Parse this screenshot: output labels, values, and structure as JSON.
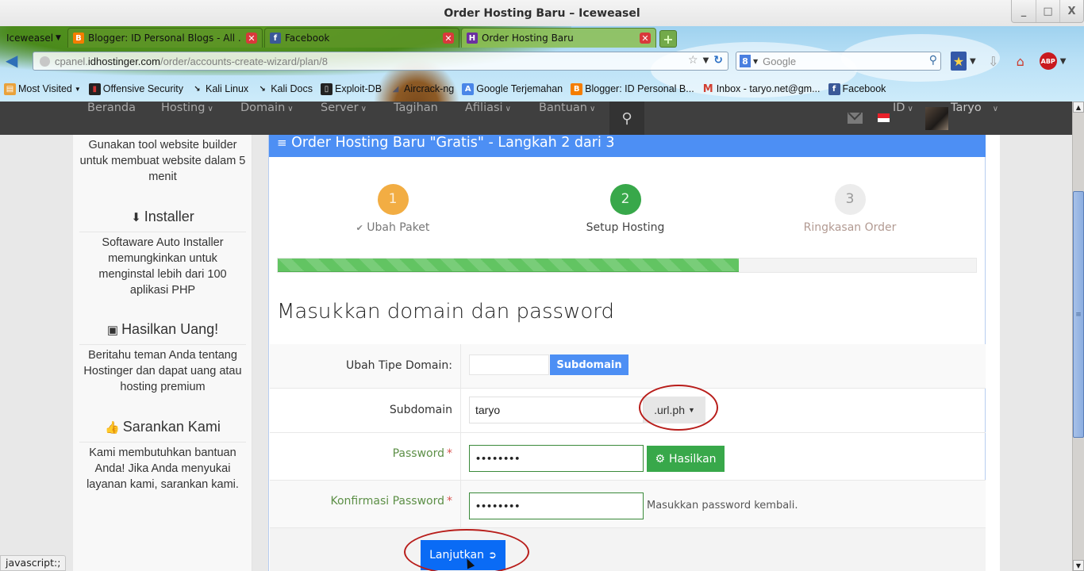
{
  "window": {
    "title": "Order Hosting Baru – Iceweasel",
    "controls": {
      "minimize": "_",
      "maximize": "□",
      "close": "X"
    }
  },
  "browser": {
    "app_menu": "Iceweasel",
    "tabs": [
      {
        "label": "Blogger: ID Personal Blogs - All ...",
        "icon": "blogger-icon",
        "active": false
      },
      {
        "label": "Facebook",
        "icon": "facebook-icon",
        "active": false
      },
      {
        "label": "Order Hosting Baru",
        "icon": "hostinger-icon",
        "active": true
      }
    ],
    "new_tab": "+",
    "url": {
      "prefix": "cpanel.",
      "domain": "idhostinger.com",
      "path": "/order/accounts-create-wizard/plan/8"
    },
    "search": {
      "engine": "8",
      "placeholder": "Google"
    },
    "bookmarks": [
      {
        "label": "Most Visited",
        "icon": "most-visited-icon",
        "dropdown": true
      },
      {
        "label": "Offensive Security",
        "icon": "offsec-icon"
      },
      {
        "label": "Kali Linux",
        "icon": "kali-icon"
      },
      {
        "label": "Kali Docs",
        "icon": "kali-icon"
      },
      {
        "label": "Exploit-DB",
        "icon": "exploitdb-icon"
      },
      {
        "label": "Aircrack-ng",
        "icon": "aircrack-icon"
      },
      {
        "label": "Google Terjemahan",
        "icon": "translate-icon"
      },
      {
        "label": "Blogger: ID Personal B...",
        "icon": "blogger-icon"
      },
      {
        "label": "Inbox - taryo.net@gm...",
        "icon": "gmail-icon"
      },
      {
        "label": "Facebook",
        "icon": "facebook-icon"
      }
    ],
    "status_text": "javascript:;"
  },
  "site_nav": {
    "items": [
      {
        "label": "Beranda",
        "dropdown": false
      },
      {
        "label": "Hosting",
        "dropdown": true
      },
      {
        "label": "Domain",
        "dropdown": true
      },
      {
        "label": "Server",
        "dropdown": true
      },
      {
        "label": "Tagihan",
        "dropdown": false
      },
      {
        "label": "Afiliasi",
        "dropdown": true
      },
      {
        "label": "Bantuan",
        "dropdown": true
      }
    ],
    "language": "ID",
    "user": "Taryo"
  },
  "sidebar": {
    "intro_text": "Gunakan tool website builder untuk membuat website dalam 5 menit",
    "sections": [
      {
        "title": "Installer",
        "icon": "download-icon",
        "text": "Softaware Auto Installer memungkinkan untuk menginstal lebih dari 100 aplikasi PHP"
      },
      {
        "title": "Hasilkan Uang!",
        "icon": "money-icon",
        "text": "Beritahu teman Anda tentang Hostinger dan dapat uang atau hosting premium"
      },
      {
        "title": "Sarankan Kami",
        "icon": "thumbs-up-icon",
        "text": "Kami membutuhkan bantuan Anda! Jika Anda menyukai layanan kami, sarankan kami."
      }
    ]
  },
  "wizard": {
    "panel_title": "Order Hosting Baru \"Gratis\" - Langkah 2 dari 3",
    "steps": [
      {
        "number": "1",
        "label": "Ubah Paket",
        "state": "completed"
      },
      {
        "number": "2",
        "label": "Setup Hosting",
        "state": "current"
      },
      {
        "number": "3",
        "label": "Ringkasan Order",
        "state": "pending"
      }
    ],
    "progress_percent": 66,
    "form_title": "Masukkan domain dan password",
    "fields": {
      "domain_type": {
        "label": "Ubah Tipe Domain:",
        "option_selected": "Subdomain"
      },
      "subdomain": {
        "label": "Subdomain",
        "value": "taryo",
        "suffix": ".url.ph"
      },
      "password": {
        "label": "Password",
        "required": "*",
        "value": "••••••••",
        "generate_label": "Hasilkan"
      },
      "confirm_password": {
        "label": "Konfirmasi Password",
        "required": "*",
        "value": "••••••••",
        "help": "Masukkan password kembali."
      }
    },
    "submit_label": "Lanjutkan"
  },
  "colors": {
    "primary_blue": "#4d8ff4",
    "submit_blue": "#0a6bf5",
    "success_green": "#38a84a",
    "step1_orange": "#f2ad43",
    "annotation_red": "#b81d1a",
    "nav_bg": "#3f3f3f"
  }
}
